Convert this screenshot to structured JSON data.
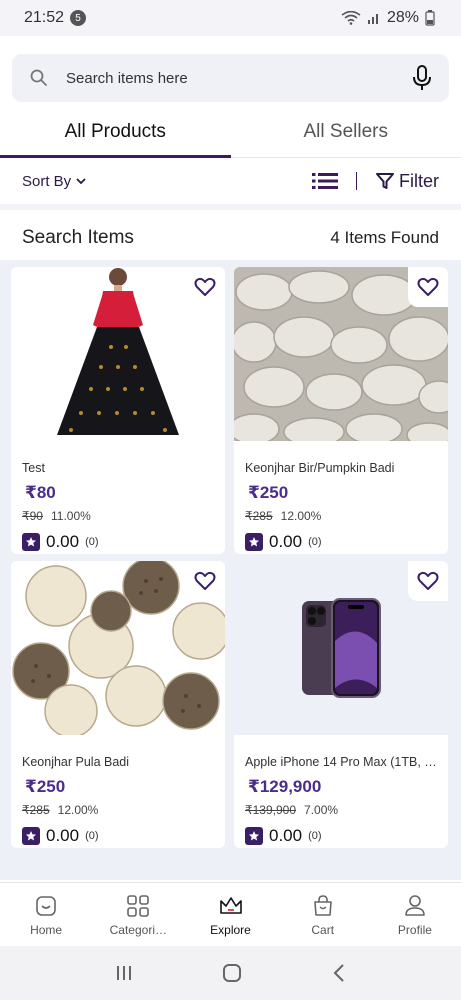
{
  "status": {
    "time": "21:52",
    "notif_count": "5",
    "battery": "28%"
  },
  "search": {
    "placeholder": "Search items here"
  },
  "tabs": [
    {
      "label": "All Products"
    },
    {
      "label": "All Sellers"
    }
  ],
  "toolbar": {
    "sort_label": "Sort By",
    "filter_label": "Filter"
  },
  "results": {
    "title": "Search Items",
    "count_text": "4 Items Found"
  },
  "products": [
    {
      "name": "Test",
      "price": "₹80",
      "mrp": "₹90",
      "discount": "11.00%",
      "rating": "0.00",
      "rating_count": "(0)"
    },
    {
      "name": "Keonjhar Bir/Pumpkin Badi",
      "price": "₹250",
      "mrp": "₹285",
      "discount": "12.00%",
      "rating": "0.00",
      "rating_count": "(0)"
    },
    {
      "name": "Keonjhar Pula Badi",
      "price": "₹250",
      "mrp": "₹285",
      "discount": "12.00%",
      "rating": "0.00",
      "rating_count": "(0)"
    },
    {
      "name": "Apple iPhone 14 Pro Max (1TB, …",
      "price": "₹129,900",
      "mrp": "₹139,900",
      "discount": "7.00%",
      "rating": "0.00",
      "rating_count": "(0)"
    }
  ],
  "bottom_nav": [
    {
      "label": "Home",
      "icon": "home-icon"
    },
    {
      "label": "Categori…",
      "icon": "categories-icon"
    },
    {
      "label": "Explore",
      "icon": "crown-icon"
    },
    {
      "label": "Cart",
      "icon": "cart-icon"
    },
    {
      "label": "Profile",
      "icon": "profile-icon"
    }
  ],
  "colors": {
    "accent": "#3d1a5c",
    "price": "#4a2d8a",
    "grid_bg": "#eef0f7"
  }
}
